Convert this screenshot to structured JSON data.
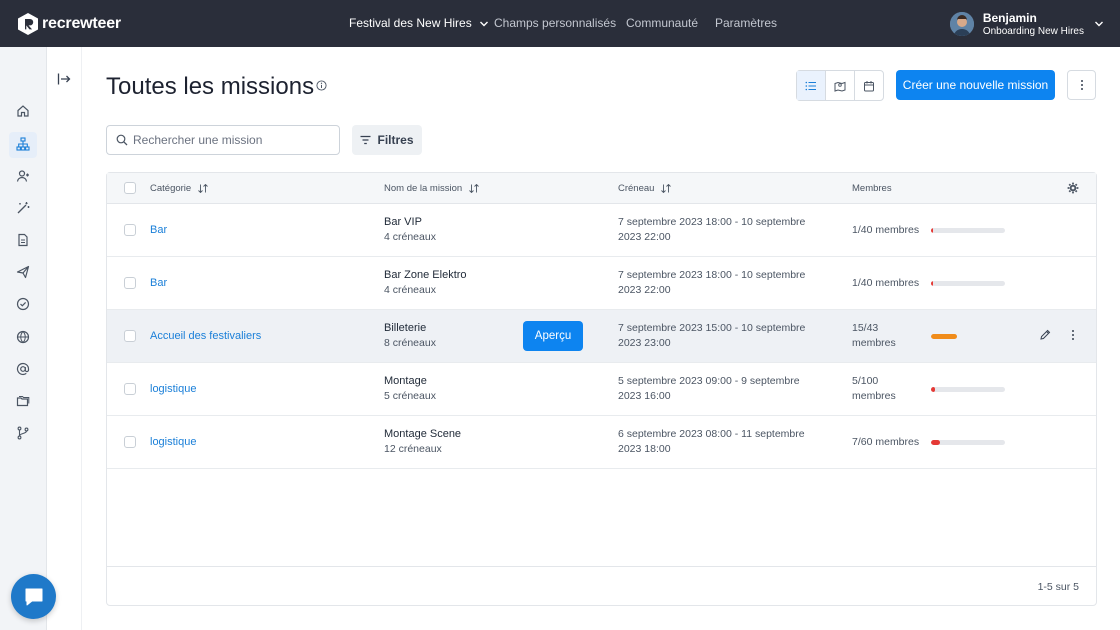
{
  "app": {
    "name": "recrewteer",
    "brand_color": "#0d84f0"
  },
  "topnav": {
    "items": [
      {
        "label": "Festival des New Hires",
        "has_dropdown": true,
        "active": true
      },
      {
        "label": "Champs personnalisés"
      },
      {
        "label": "Communauté"
      },
      {
        "label": "Paramètres"
      }
    ]
  },
  "user": {
    "name": "Benjamin",
    "org": "Onboarding New Hires"
  },
  "sidebar": {
    "icons": [
      "home-icon",
      "org-chart-icon",
      "users-icon",
      "magic-wand-icon",
      "document-icon",
      "send-icon",
      "check-circle-icon",
      "globe-icon",
      "at-sign-icon",
      "folders-icon",
      "git-branch-icon"
    ],
    "active": "org-chart-icon"
  },
  "page": {
    "title": "Toutes les missions",
    "create_label": "Créer une nouvelle mission",
    "search_placeholder": "Rechercher une mission",
    "filters_label": "Filtres",
    "view_modes": [
      "list-view-icon",
      "map-view-icon",
      "calendar-view-icon"
    ],
    "active_view": "list-view-icon"
  },
  "table": {
    "columns": {
      "category": "Catégorie",
      "name": "Nom de la mission",
      "slot": "Créneau",
      "members": "Membres"
    },
    "rows": [
      {
        "category": "Bar",
        "name": "Bar VIP",
        "slots": "4 créneaux",
        "slot": "7 septembre 2023 18:00 - 10 septembre 2023 22:00",
        "members": "1/40 membres",
        "fill": 0.025,
        "color": "#e53935"
      },
      {
        "category": "Bar",
        "name": "Bar Zone Elektro",
        "slots": "4 créneaux",
        "slot": "7 septembre 2023 18:00 - 10 septembre 2023 22:00",
        "members": "1/40 membres",
        "fill": 0.025,
        "color": "#e53935"
      },
      {
        "category": "Accueil des festivaliers",
        "name": "Billeterie",
        "slots": "8 créneaux",
        "slot": "7 septembre 2023 15:00 - 10 septembre 2023 23:00",
        "members": "15/43 membres",
        "fill": 0.349,
        "color": "#f08c1a",
        "hover": true,
        "preview_label": "Aperçu"
      },
      {
        "category": "logistique",
        "name": "Montage",
        "slots": "5 créneaux",
        "slot": "5 septembre 2023 09:00 - 9 septembre 2023 16:00",
        "members": "5/100 membres",
        "fill": 0.05,
        "color": "#e53935"
      },
      {
        "category": "logistique",
        "name": "Montage Scene",
        "slots": "12 créneaux",
        "slot": "6 septembre 2023 08:00 - 11 septembre 2023 18:00",
        "members": "7/60 membres",
        "fill": 0.117,
        "color": "#e53935"
      }
    ],
    "pagination": "1-5 sur 5"
  }
}
